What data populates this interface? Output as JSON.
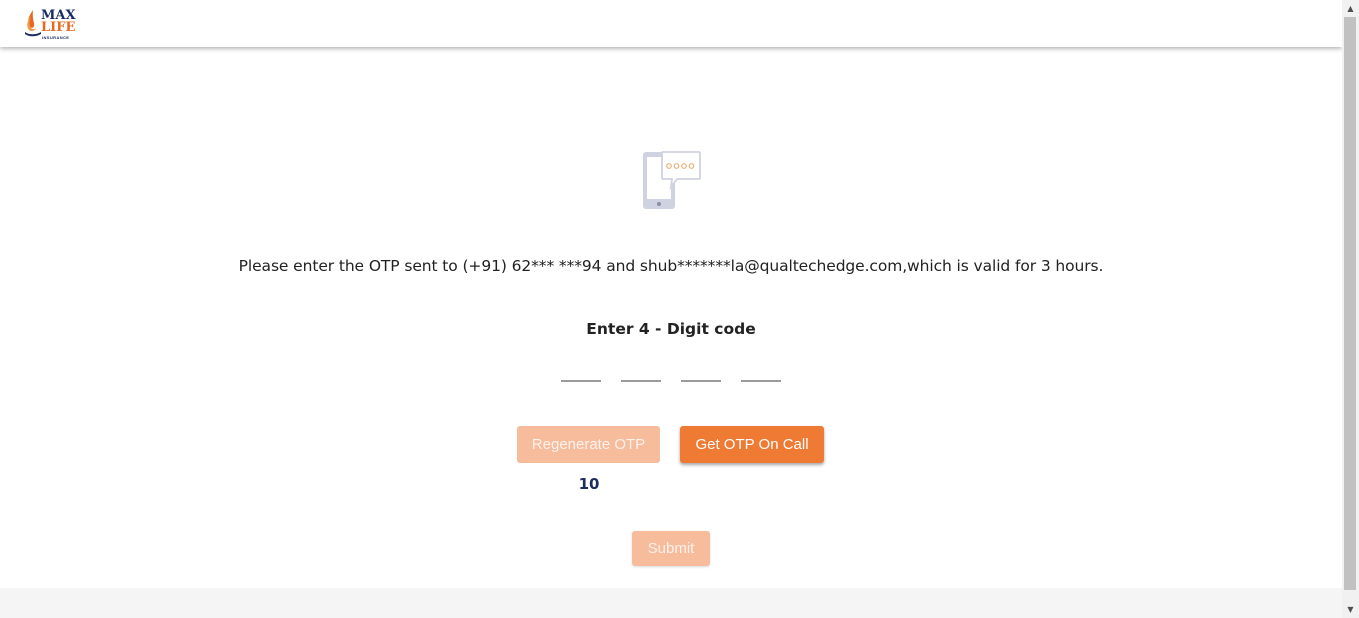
{
  "brand": {
    "logo_line1": "MAX",
    "logo_line2": "LIFE",
    "logo_line3": "INSURANCE",
    "primary_color": "#ef7a33",
    "disabled_color": "#f6bc9b",
    "navy_color": "#1b2a63"
  },
  "otp": {
    "icon": "phone-message-icon",
    "message": "Please enter the OTP sent to (+91) 62*** ***94 and shub*******la@qualtechedge.com,which is valid for 3 hours.",
    "code_label": "Enter 4 - Digit code",
    "digit_count": 4,
    "inputs": [
      "",
      "",
      "",
      ""
    ]
  },
  "actions": {
    "regenerate_label": "Regenerate OTP",
    "call_label": "Get OTP On Call",
    "countdown": "10",
    "submit_label": "Submit"
  }
}
